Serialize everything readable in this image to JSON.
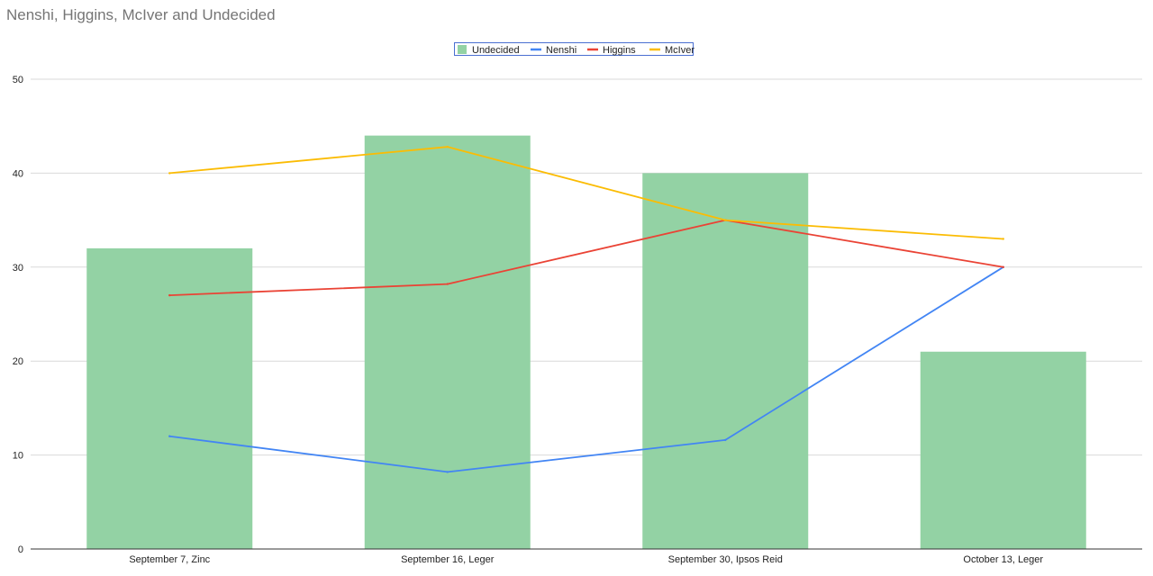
{
  "title": "Nenshi, Higgins, McIver and Undecided",
  "chart_data": {
    "type": "bar",
    "title": "Nenshi, Higgins, McIver and Undecided",
    "categories": [
      "September 7, Zinc",
      "September 16, Leger",
      "September 30, Ipsos Reid",
      "October 13, Leger"
    ],
    "ylim": [
      0,
      50
    ],
    "yticks": [
      0,
      10,
      20,
      30,
      40,
      50
    ],
    "grid": true,
    "legend_position": "top",
    "series": [
      {
        "name": "Undecided",
        "kind": "bar",
        "color": "#93d2a4",
        "values": [
          32,
          44,
          40,
          21
        ]
      },
      {
        "name": "Nenshi",
        "kind": "line",
        "color": "#4285f4",
        "values": [
          12,
          8.2,
          11.6,
          30
        ]
      },
      {
        "name": "Higgins",
        "kind": "line",
        "color": "#ea4335",
        "values": [
          27,
          28.2,
          35,
          30
        ]
      },
      {
        "name": "McIver",
        "kind": "line",
        "color": "#fbbc04",
        "values": [
          40,
          42.8,
          35,
          33
        ]
      }
    ]
  }
}
